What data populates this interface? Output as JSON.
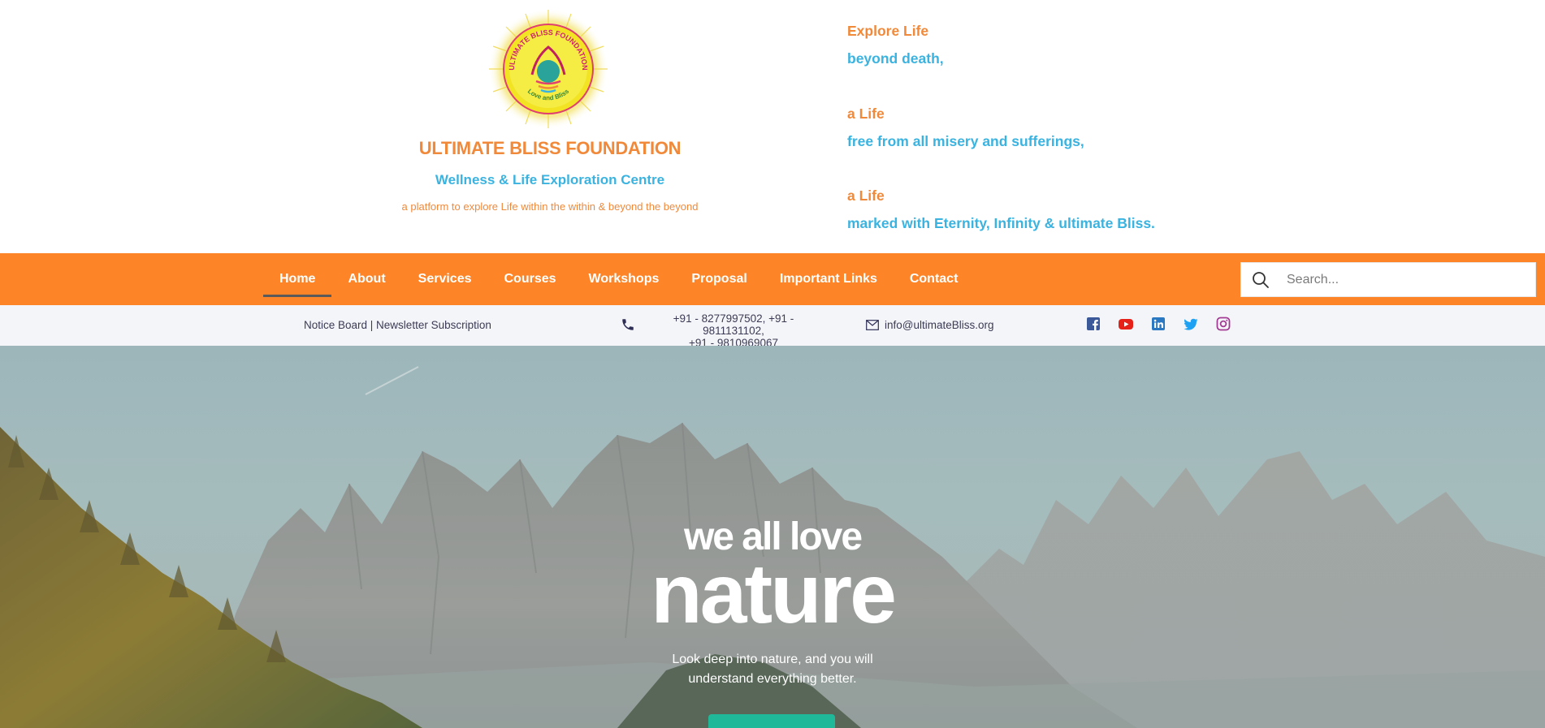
{
  "header": {
    "org_name": "ULTIMATE BLISS FOUNDATION",
    "subtitle": "Wellness & Life Exploration Centre",
    "tagline": "a platform to explore Life within the within & beyond the beyond",
    "logo": {
      "icon": "sun-emblem-logo",
      "text_top": "ULTIMATE BLISS FOUNDATION",
      "text_bottom": "Love and Bliss"
    }
  },
  "explore": {
    "line1": "Explore Life",
    "line2": "beyond death,",
    "line3": "a Life",
    "line4": "free from all misery and sufferings,",
    "line5": "a Life",
    "line6": "marked with Eternity, Infinity & ultimate Bliss."
  },
  "nav": {
    "items": [
      {
        "label": "Home",
        "active": true
      },
      {
        "label": "About"
      },
      {
        "label": "Services"
      },
      {
        "label": "Courses"
      },
      {
        "label": "Workshops"
      },
      {
        "label": "Proposal"
      },
      {
        "label": "Important Links"
      },
      {
        "label": "Contact"
      }
    ],
    "search_placeholder": "Search...",
    "search_icon": "search-icon"
  },
  "info": {
    "notice_text": "Notice Board | Newsletter Subscription",
    "phone_line1": "+91 - 8277997502, +91 - 9811131102,",
    "phone_line2": "+91 - 9810969067",
    "phone_icon": "phone-icon",
    "email": "info@ultimateBliss.org",
    "email_icon": "mail-icon",
    "social": [
      "facebook-icon",
      "youtube-icon",
      "linkedin-icon",
      "twitter-icon",
      "instagram-icon"
    ]
  },
  "hero": {
    "pre_title": "we all love",
    "title": "nature",
    "description_line1": "Look deep into nature, and you will",
    "description_line2": "understand everything better."
  },
  "colors": {
    "brand_orange": "#fd8527",
    "title_orange": "#f0893a",
    "accent_blue": "#3ab3e0",
    "button_teal": "#1fb899",
    "facebook": "#3b5998",
    "youtube": "#e62117",
    "linkedin": "#2b78c2",
    "twitter": "#1da1f2",
    "instagram": "#a23b93"
  }
}
